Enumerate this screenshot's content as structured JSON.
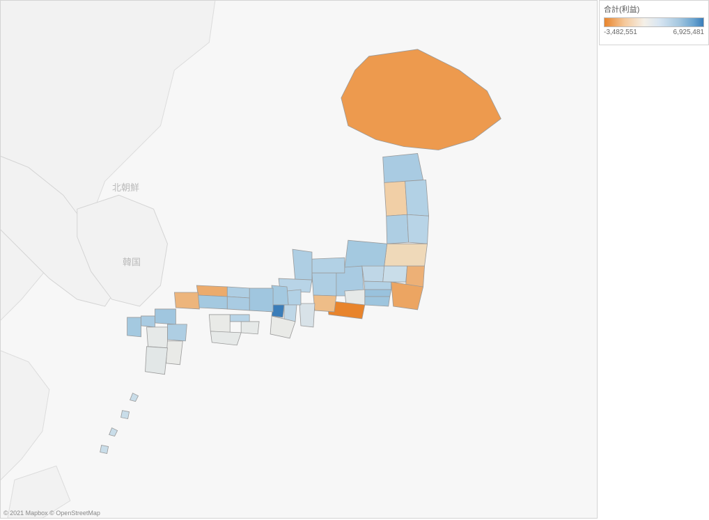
{
  "legend": {
    "title": "合計(利益)",
    "min_label": "-3,482,551",
    "max_label": "6,925,481"
  },
  "map_labels": {
    "north_korea": "北朝鮮",
    "south_korea": "韓国"
  },
  "attribution": "© 2021 Mapbox © OpenStreetMap",
  "chart_data": {
    "type": "choropleth-map",
    "title": "合計(利益)",
    "geography": "Japan prefectures",
    "color_scale": {
      "min": -3482551,
      "max": 6925481,
      "low_color": "#e8842c",
      "mid_color": "#f2efe8",
      "high_color": "#3a7db9"
    },
    "series": [
      {
        "name": "Hokkaido",
        "value": -3000000,
        "color": "#ed9a4e"
      },
      {
        "name": "Aomori",
        "value": 2500000,
        "color": "#a9cbe2"
      },
      {
        "name": "Iwate",
        "value": 2000000,
        "color": "#b2d1e5"
      },
      {
        "name": "Miyagi",
        "value": 1800000,
        "color": "#b8d4e7"
      },
      {
        "name": "Akita",
        "value": -800000,
        "color": "#f1cfa6"
      },
      {
        "name": "Yamagata",
        "value": 2200000,
        "color": "#aeceE3"
      },
      {
        "name": "Fukushima",
        "value": -400000,
        "color": "#efd9b9"
      },
      {
        "name": "Ibaraki",
        "value": -1600000,
        "color": "#edb076"
      },
      {
        "name": "Tochigi",
        "value": 1000000,
        "color": "#c9dde9"
      },
      {
        "name": "Gunma",
        "value": 1500000,
        "color": "#bfd7e7"
      },
      {
        "name": "Saitama",
        "value": 2000000,
        "color": "#b2d1e5"
      },
      {
        "name": "Chiba",
        "value": -2200000,
        "color": "#eca562"
      },
      {
        "name": "Tokyo",
        "value": 3500000,
        "color": "#99c2dd"
      },
      {
        "name": "Kanagawa",
        "value": 3200000,
        "color": "#9ec5de"
      },
      {
        "name": "Niigata",
        "value": 2800000,
        "color": "#a4c9e0"
      },
      {
        "name": "Toyama",
        "value": 2000000,
        "color": "#b2d1e5"
      },
      {
        "name": "Ishikawa",
        "value": 2200000,
        "color": "#aecee3"
      },
      {
        "name": "Fukui",
        "value": 1800000,
        "color": "#b8d4e7"
      },
      {
        "name": "Yamanashi",
        "value": 200000,
        "color": "#e6e9e8"
      },
      {
        "name": "Nagano",
        "value": 2500000,
        "color": "#a9cbe2"
      },
      {
        "name": "Gifu",
        "value": 2200000,
        "color": "#aecee3"
      },
      {
        "name": "Shizuoka",
        "value": -3482551,
        "color": "#e8842c"
      },
      {
        "name": "Aichi",
        "value": -1200000,
        "color": "#eebd88"
      },
      {
        "name": "Mie",
        "value": 500000,
        "color": "#d8e2e8"
      },
      {
        "name": "Shiga",
        "value": 2000000,
        "color": "#b2d1e5"
      },
      {
        "name": "Kyoto",
        "value": 2800000,
        "color": "#a4c9e0"
      },
      {
        "name": "Osaka",
        "value": 6925481,
        "color": "#3a7db9"
      },
      {
        "name": "Hyogo",
        "value": 3000000,
        "color": "#a0c6df"
      },
      {
        "name": "Nara",
        "value": 1500000,
        "color": "#bfd7e7"
      },
      {
        "name": "Wakayama",
        "value": 100000,
        "color": "#e9eae7"
      },
      {
        "name": "Tottori",
        "value": 2200000,
        "color": "#aecee3"
      },
      {
        "name": "Shimane",
        "value": -1800000,
        "color": "#ecab6c"
      },
      {
        "name": "Okayama",
        "value": 2500000,
        "color": "#a9cbe2"
      },
      {
        "name": "Hiroshima",
        "value": 2800000,
        "color": "#a4c9e0"
      },
      {
        "name": "Yamaguchi",
        "value": -1500000,
        "color": "#edb57c"
      },
      {
        "name": "Tokushima",
        "value": 200000,
        "color": "#e6e9e8"
      },
      {
        "name": "Kagawa",
        "value": 1800000,
        "color": "#b8d4e7"
      },
      {
        "name": "Ehime",
        "value": 100000,
        "color": "#e9eae7"
      },
      {
        "name": "Kochi",
        "value": 200000,
        "color": "#e6e9e8"
      },
      {
        "name": "Fukuoka",
        "value": 3000000,
        "color": "#a0c6df"
      },
      {
        "name": "Saga",
        "value": 2500000,
        "color": "#a9cbe2"
      },
      {
        "name": "Nagasaki",
        "value": 2800000,
        "color": "#a4c9e0"
      },
      {
        "name": "Kumamoto",
        "value": 200000,
        "color": "#e6e9e8"
      },
      {
        "name": "Oita",
        "value": 2200000,
        "color": "#aecee3"
      },
      {
        "name": "Miyazaki",
        "value": 100000,
        "color": "#e9eae7"
      },
      {
        "name": "Kagoshima",
        "value": 300000,
        "color": "#e2e7e7"
      },
      {
        "name": "Okinawa",
        "value": 1000000,
        "color": "#c9dde9"
      }
    ]
  }
}
